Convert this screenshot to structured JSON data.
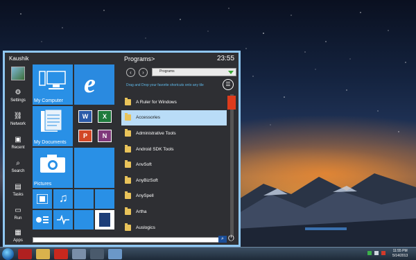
{
  "start_menu": {
    "user_name": "Kaushik",
    "nav": [
      {
        "label": "Settings",
        "icon": "gear-icon",
        "glyph": "⚙"
      },
      {
        "label": "Network",
        "icon": "network-icon",
        "glyph": "⛓"
      },
      {
        "label": "Recent",
        "icon": "recent-icon",
        "glyph": "▣"
      },
      {
        "label": "Search",
        "icon": "search-icon",
        "glyph": "⌕"
      },
      {
        "label": "Tasks",
        "icon": "tasks-icon",
        "glyph": "▤"
      },
      {
        "label": "Run",
        "icon": "run-icon",
        "glyph": "▭"
      },
      {
        "label": "Apps",
        "icon": "apps-icon",
        "glyph": "▦"
      }
    ],
    "tiles": {
      "my_computer": "My Computer",
      "my_documents": "My Documents",
      "pictures": "Pictures",
      "word": "W",
      "excel": "X",
      "powerpoint": "P",
      "onenote": "N"
    },
    "programs_header": "Programs>",
    "clock": "23:55",
    "dropdown_value": "Programs",
    "hint": "Drag and Drop your favorite shortcuts onto any tile",
    "programs": [
      {
        "name": "A Ruler for Windows"
      },
      {
        "name": "Accessories",
        "selected": true
      },
      {
        "name": "Administrative Tools"
      },
      {
        "name": "Android SDK Tools"
      },
      {
        "name": "AnvSoft"
      },
      {
        "name": "AnyBizSoft"
      },
      {
        "name": "AnySpell"
      },
      {
        "name": "Artha"
      },
      {
        "name": "Auslogics"
      }
    ]
  },
  "taskbar": {
    "time": "11:55 PM",
    "date": "5/14/2013"
  },
  "colors": {
    "tile_blue": "#2990e6",
    "menu_border": "#8fc7f2",
    "menu_bg": "#2e2f33",
    "word": "#2b5aa8",
    "excel": "#1e7b3c",
    "powerpoint": "#d24726",
    "onenote": "#80397b",
    "scroll_thumb": "#dd3b1c"
  }
}
